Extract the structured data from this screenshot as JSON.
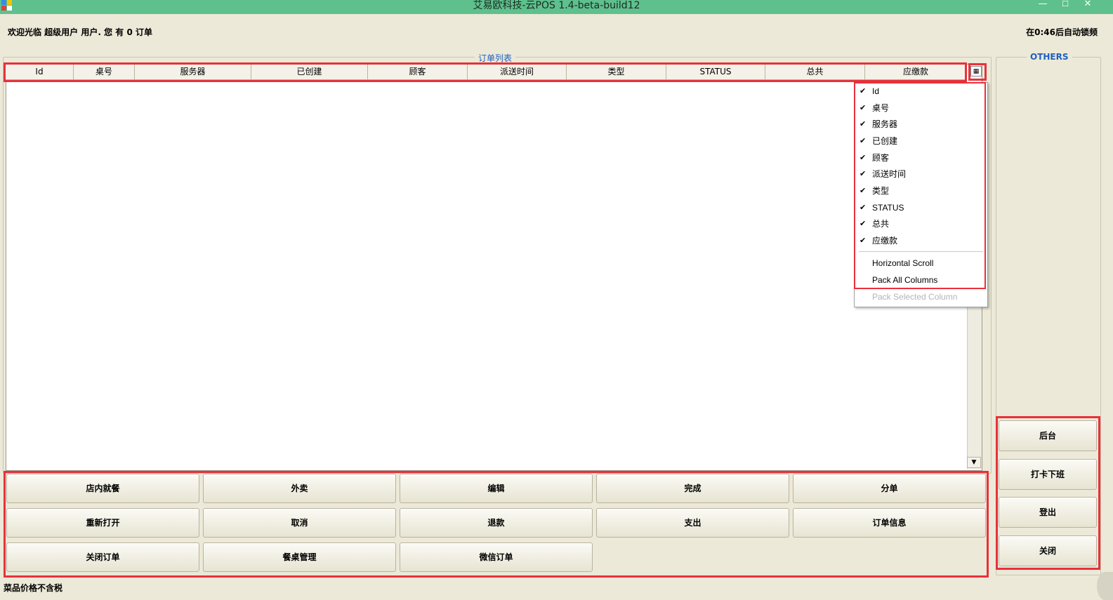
{
  "window": {
    "title": "艾易欧科技-云POS 1.4-beta-build12",
    "minimize": "—",
    "close": "✕"
  },
  "header": {
    "welcome": "欢迎光临 超级用户 用户. 您 有 0 订单",
    "autolock": "在0:46后自动锁频"
  },
  "order_list": {
    "title": "订单列表",
    "columns": [
      "Id",
      "桌号",
      "服务器",
      "已创建",
      "顾客",
      "派送时间",
      "类型",
      "STATUS",
      "总共",
      "应缴款"
    ]
  },
  "column_menu": {
    "check": "✔",
    "items": [
      "Id",
      "桌号",
      "服务器",
      "已创建",
      "顾客",
      "派送时间",
      "类型",
      "STATUS",
      "总共",
      "应缴款"
    ],
    "actions": [
      "Horizontal Scroll",
      "Pack All Columns",
      "Pack Selected Column"
    ]
  },
  "actions": {
    "row1": [
      "店内就餐",
      "外卖",
      "编辑",
      "完成",
      "分单"
    ],
    "row2": [
      "重新打开",
      "取消",
      "退款",
      "支出",
      "订单信息"
    ],
    "row3": [
      "关闭订单",
      "餐桌管理",
      "微信订单"
    ]
  },
  "others": {
    "title": "OTHERS",
    "buttons": [
      "后台",
      "打卡下班",
      "登出",
      "关闭"
    ]
  },
  "footer": {
    "note": "菜品价格不含税"
  },
  "colors": {
    "titlebar": "#5EC08D",
    "background": "#ECE9D8",
    "group_title": "#1f5fbf",
    "highlight": "#E8313B"
  }
}
